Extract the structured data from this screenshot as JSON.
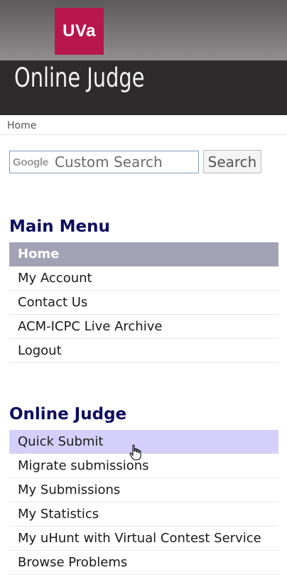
{
  "header": {
    "logo_text": "UVa",
    "site_title": "Online Judge"
  },
  "breadcrumb": {
    "home": "Home"
  },
  "search": {
    "google_label": "Google",
    "placeholder": "Custom Search",
    "button_label": "Search"
  },
  "main_menu": {
    "heading": "Main Menu",
    "items": [
      {
        "label": "Home",
        "state": "active"
      },
      {
        "label": "My Account"
      },
      {
        "label": "Contact Us"
      },
      {
        "label": "ACM-ICPC Live Archive"
      },
      {
        "label": "Logout"
      }
    ]
  },
  "judge_menu": {
    "heading": "Online Judge",
    "items": [
      {
        "label": "Quick Submit",
        "state": "hover"
      },
      {
        "label": "Migrate submissions"
      },
      {
        "label": "My Submissions"
      },
      {
        "label": "My Statistics"
      },
      {
        "label": "My uHunt with Virtual Contest Service"
      },
      {
        "label": "Browse Problems"
      }
    ]
  },
  "colors": {
    "logo": "#b8174e",
    "heading": "#0d0d5f",
    "active_item": "#a3a2b5",
    "hover_item": "#d4d0fb"
  }
}
